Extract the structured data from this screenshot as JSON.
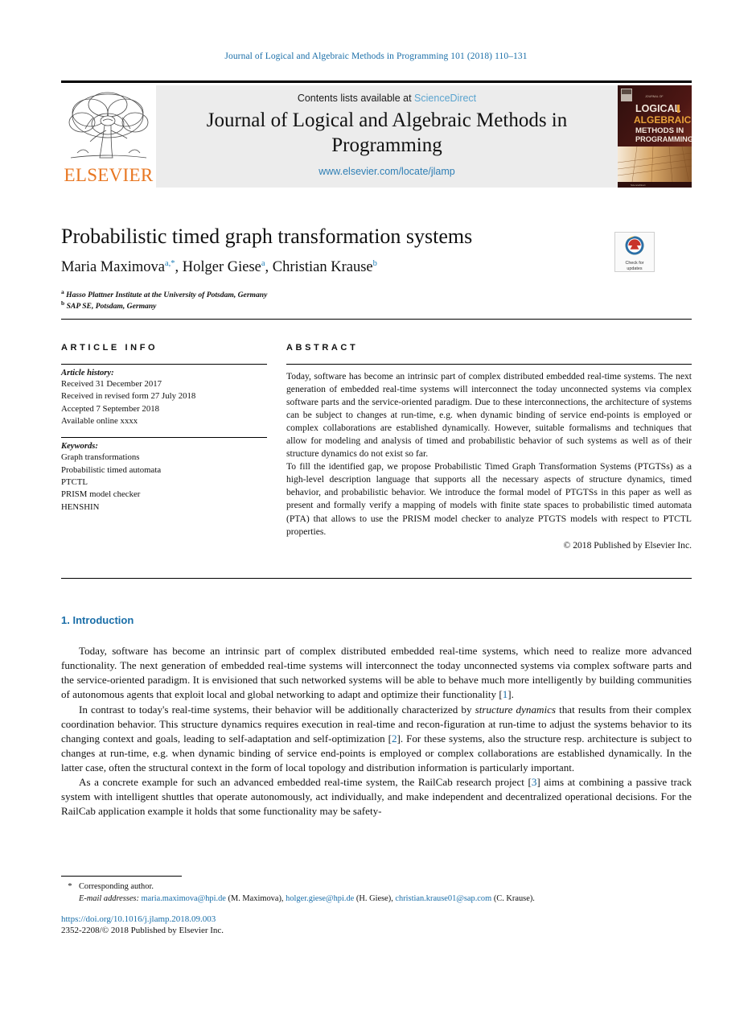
{
  "running_head": "Journal of Logical and Algebraic Methods in Programming 101 (2018) 110–131",
  "masthead": {
    "publisher": "ELSEVIER",
    "contents_prefix": "Contents lists available at",
    "sciencedirect": "ScienceDirect",
    "journal_title": "Journal of Logical and Algebraic Methods in Programming",
    "journal_url": "www.elsevier.com/locate/jlamp",
    "cover": {
      "line1": "LOGICAL",
      "line2": "ALGEBRAIC",
      "line3": "METHODS IN",
      "line4": "PROGRAMMING",
      "small_top": "JOURNAL OF"
    },
    "colors": {
      "link_blue": "#5ba4cf",
      "url_blue": "#2f7fb5",
      "elsevier_orange": "#E87722",
      "band_gray": "#ececec"
    }
  },
  "article": {
    "title": "Probabilistic timed graph transformation systems",
    "authors_html": "Maria Maximova<sup>a,*</sup>, Holger Giese<sup>a</sup>, Christian Krause<sup>b</sup>",
    "affiliation_a": "Hasso Plattner Institute at the University of Potsdam, Germany",
    "affiliation_b": "SAP SE, Potsdam, Germany",
    "crossmark_line1": "Check for",
    "crossmark_line2": "updates"
  },
  "article_info": {
    "heading": "ARTICLE INFO",
    "history_label": "Article history:",
    "history": [
      "Received 31 December 2017",
      "Received in revised form 27 July 2018",
      "Accepted 7 September 2018",
      "Available online xxxx"
    ],
    "keywords_label": "Keywords:",
    "keywords": [
      "Graph transformations",
      "Probabilistic timed automata",
      "PTCTL",
      "PRISM model checker",
      "HENSHIN"
    ]
  },
  "abstract": {
    "heading": "ABSTRACT",
    "paragraph1": "Today, software has become an intrinsic part of complex distributed embedded real-time systems. The next generation of embedded real-time systems will interconnect the today unconnected systems via complex software parts and the service-oriented paradigm. Due to these interconnections, the architecture of systems can be subject to changes at run-time, e.g. when dynamic binding of service end-points is employed or complex collaborations are established dynamically. However, suitable formalisms and techniques that allow for modeling and analysis of timed and probabilistic behavior of such systems as well as of their structure dynamics do not exist so far.",
    "paragraph2": "To fill the identified gap, we propose Probabilistic Timed Graph Transformation Systems (PTGTSs) as a high-level description language that supports all the necessary aspects of structure dynamics, timed behavior, and probabilistic behavior. We introduce the formal model of PTGTSs in this paper as well as present and formally verify a mapping of models with finite state spaces to probabilistic timed automata (PTA) that allows to use the PRISM model checker to analyze PTGTS models with respect to PTCTL properties.",
    "copyright": "© 2018 Published by Elsevier Inc."
  },
  "section1": {
    "heading": "1. Introduction",
    "paragraph1_html": "Today, software has become an intrinsic part of complex distributed embedded real-time systems, which need to realize more advanced functionality. The next generation of embedded real-time systems will interconnect the today unconnected systems via complex software parts and the service-oriented paradigm. It is envisioned that such networked systems will be able to behave much more intelligently by building communities of autonomous agents that exploit local and global networking to adapt and optimize their functionality [<span class=\"cite\">1</span>].",
    "paragraph2_html": "In contrast to today's real-time systems, their behavior will be additionally characterized by <em>structure dynamics</em> that results from their complex coordination behavior. This structure dynamics requires execution in real-time and recon-figuration at run-time to adjust the systems behavior to its changing context and goals, leading to self-adaptation and self-optimization [<span class=\"cite\">2</span>]. For these systems, also the structure resp. architecture is subject to changes at run-time, e.g. when dynamic binding of service end-points is employed or complex collaborations are established dynamically. In the latter case, often the structural context in the form of local topology and distribution information is particularly important.",
    "paragraph3_html": "As a concrete example for such an advanced embedded real-time system, the RailCab research project [<span class=\"cite\">3</span>] aims at combining a passive track system with intelligent shuttles that operate autonomously, act individually, and make independent and decentralized operational decisions. For the RailCab application example it holds that some functionality may be safety-"
  },
  "footer": {
    "corresponding_author": "Corresponding author.",
    "email_label": "E-mail addresses:",
    "emails": [
      {
        "address": "maria.maximova@hpi.de",
        "name": "(M. Maximova)"
      },
      {
        "address": "holger.giese@hpi.de",
        "name": "(H. Giese)"
      },
      {
        "address": "christian.krause01@sap.com",
        "name": "(C. Krause)."
      }
    ],
    "doi": "https://doi.org/10.1016/j.jlamp.2018.09.003",
    "issn_line": "2352-2208/© 2018 Published by Elsevier Inc."
  }
}
